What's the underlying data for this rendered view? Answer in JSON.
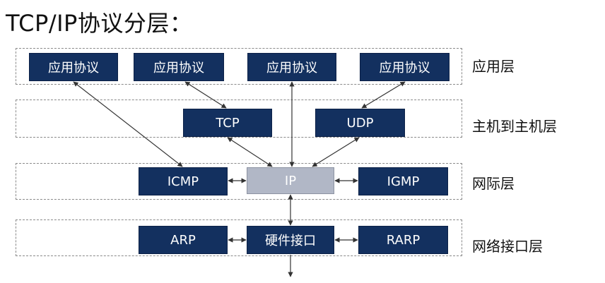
{
  "title": "TCP/IP协议分层：",
  "layers": {
    "application": {
      "label": "应用层",
      "boxes": [
        "应用协议",
        "应用协议",
        "应用协议",
        "应用协议"
      ]
    },
    "host_to_host": {
      "label": "主机到主机层",
      "boxes": [
        "TCP",
        "UDP"
      ]
    },
    "internet": {
      "label": "网际层",
      "boxes": [
        "ICMP",
        "IP",
        "IGMP"
      ]
    },
    "network_interface": {
      "label": "网络接口层",
      "boxes": [
        "ARP",
        "硬件接口",
        "RARP"
      ]
    }
  },
  "colors": {
    "box_fill": "#13305f",
    "ip_fill": "#b1b7c6",
    "arrow": "#333333",
    "layer_border": "#8a8a8a"
  }
}
